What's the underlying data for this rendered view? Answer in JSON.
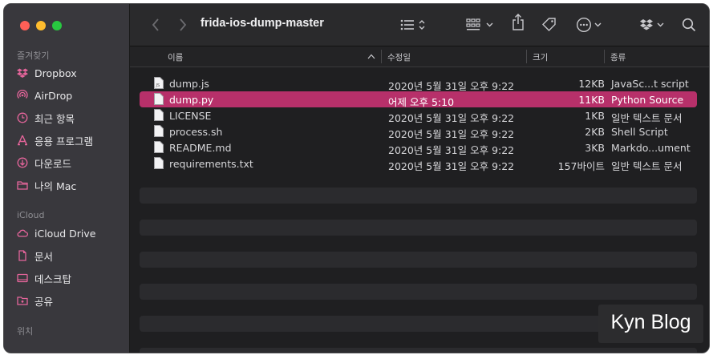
{
  "window": {
    "title": "frida-ios-dump-master"
  },
  "sidebar": {
    "favorites_title": "즐겨찾기",
    "favorites": [
      {
        "label": "Dropbox",
        "icon": "dropbox-icon"
      },
      {
        "label": "AirDrop",
        "icon": "airdrop-icon"
      },
      {
        "label": "최근 항목",
        "icon": "clock-icon"
      },
      {
        "label": "응용 프로그램",
        "icon": "applications-icon"
      },
      {
        "label": "다운로드",
        "icon": "download-icon"
      },
      {
        "label": "나의 Mac",
        "icon": "folder-icon"
      }
    ],
    "icloud_title": "iCloud",
    "icloud": [
      {
        "label": "iCloud Drive",
        "icon": "cloud-icon"
      },
      {
        "label": "문서",
        "icon": "document-icon"
      },
      {
        "label": "데스크탑",
        "icon": "desktop-icon"
      },
      {
        "label": "공유",
        "icon": "shared-folder-icon"
      }
    ],
    "locations_title": "위치",
    "accent_color": "#e5659b"
  },
  "columns": {
    "name": "이름",
    "date": "수정일",
    "size": "크기",
    "kind": "종류"
  },
  "files": [
    {
      "name": "dump.js",
      "date": "2020년 5월 31일 오후 9:22",
      "size": "12KB",
      "kind": "JavaSc...t script"
    },
    {
      "name": "dump.py",
      "date": "어제 오후 5:10",
      "size": "11KB",
      "kind": "Python Source",
      "selected": true
    },
    {
      "name": "LICENSE",
      "date": "2020년 5월 31일 오후 9:22",
      "size": "1KB",
      "kind": "일반 텍스트 문서"
    },
    {
      "name": "process.sh",
      "date": "2020년 5월 31일 오후 9:22",
      "size": "2KB",
      "kind": "Shell Script"
    },
    {
      "name": "README.md",
      "date": "2020년 5월 31일 오후 9:22",
      "size": "3KB",
      "kind": "Markdo...ument"
    },
    {
      "name": "requirements.txt",
      "date": "2020년 5월 31일 오후 9:22",
      "size": "157바이트",
      "kind": "일반 텍스트 문서"
    }
  ],
  "selection_color": "#b7306a",
  "watermark": "Kyn Blog"
}
